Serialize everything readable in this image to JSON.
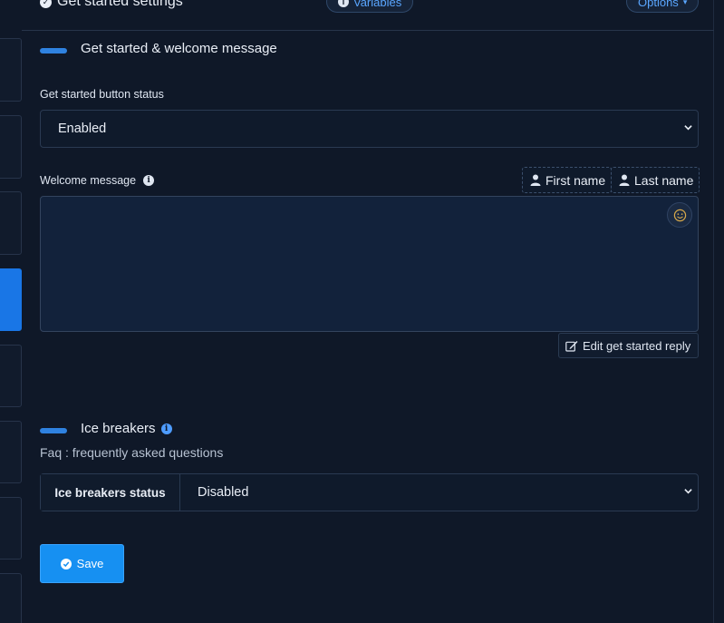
{
  "header": {
    "title": "Get started settings",
    "variables_label": "Variables",
    "options_label": "Options"
  },
  "welcome_section": {
    "title": "Get started & welcome message",
    "button_status_label": "Get started button status",
    "button_status_value": "Enabled",
    "welcome_label": "Welcome message",
    "first_name_label": "First name",
    "last_name_label": "Last name",
    "welcome_text": "",
    "edit_reply_label": "Edit get started reply"
  },
  "ice_section": {
    "title": "Ice breakers",
    "description": "Faq : frequently asked questions",
    "status_label": "Ice breakers status",
    "status_value": "Disabled"
  },
  "save_label": "Save",
  "colors": {
    "background": "#0f1828",
    "accent": "#2f82e0",
    "primary_button": "#1690f2",
    "active_sidebar": "#1976e6"
  },
  "icons": [
    "info-icon",
    "user-icon",
    "emoji-icon",
    "edit-icon",
    "check-circle-icon",
    "chevron-down-icon"
  ]
}
